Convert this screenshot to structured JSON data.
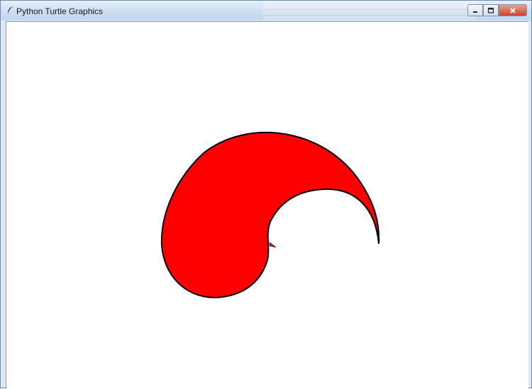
{
  "window": {
    "title": "Python Turtle Graphics",
    "controls": {
      "minimize_icon": "minimize-icon",
      "maximize_icon": "maximize-icon",
      "close_icon": "close-icon"
    }
  },
  "drawing": {
    "shape": "yin-yang-half",
    "fill_color": "#ff0000",
    "stroke_color": "#000000",
    "turtle_color": "#ff0000"
  }
}
